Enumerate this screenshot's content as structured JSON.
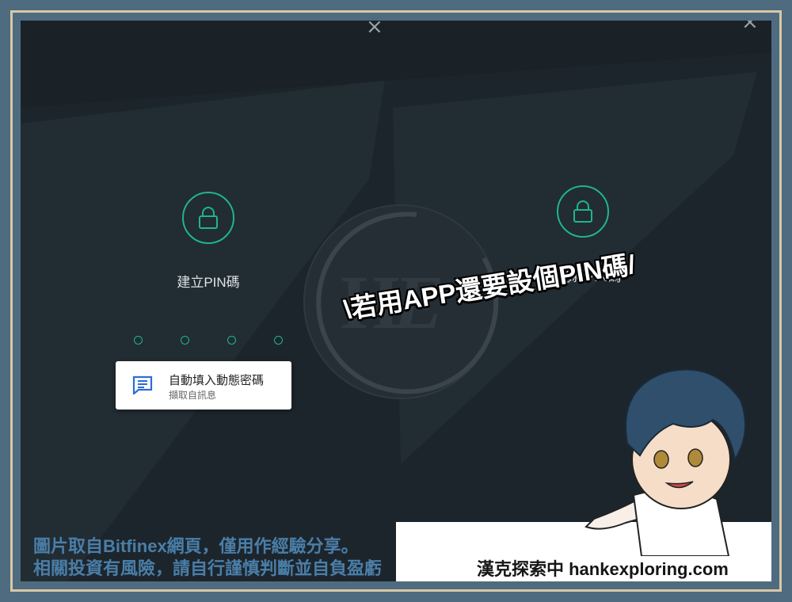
{
  "dialog": {
    "close_icon": "×",
    "steps": [
      {
        "label": "建立PIN碼",
        "icon": "lock-icon"
      },
      {
        "label": "確認新PIN碼",
        "icon": "lock-icon"
      }
    ],
    "pin_dots_count": 4
  },
  "autofill": {
    "title": "自動填入動態密碼",
    "subtitle": "擷取自訊息",
    "icon": "message-icon"
  },
  "watermark": {
    "text": "H",
    "script_letter": "E"
  },
  "callout": "\\若用APP還要設個PIN碼/",
  "footer": {
    "disclaimer_line1": "圖片取自Bitfinex網頁，僅用作經驗分享。",
    "disclaimer_line2": "相關投資有風險，請自行謹慎判斷並自負盈虧",
    "brand": "漢克探索中 hankexploring.com"
  },
  "colors": {
    "accent": "#1fb58c",
    "background": "#1d252c",
    "frame": "#4f6b80",
    "disclaimer": "#4a7ea8"
  }
}
